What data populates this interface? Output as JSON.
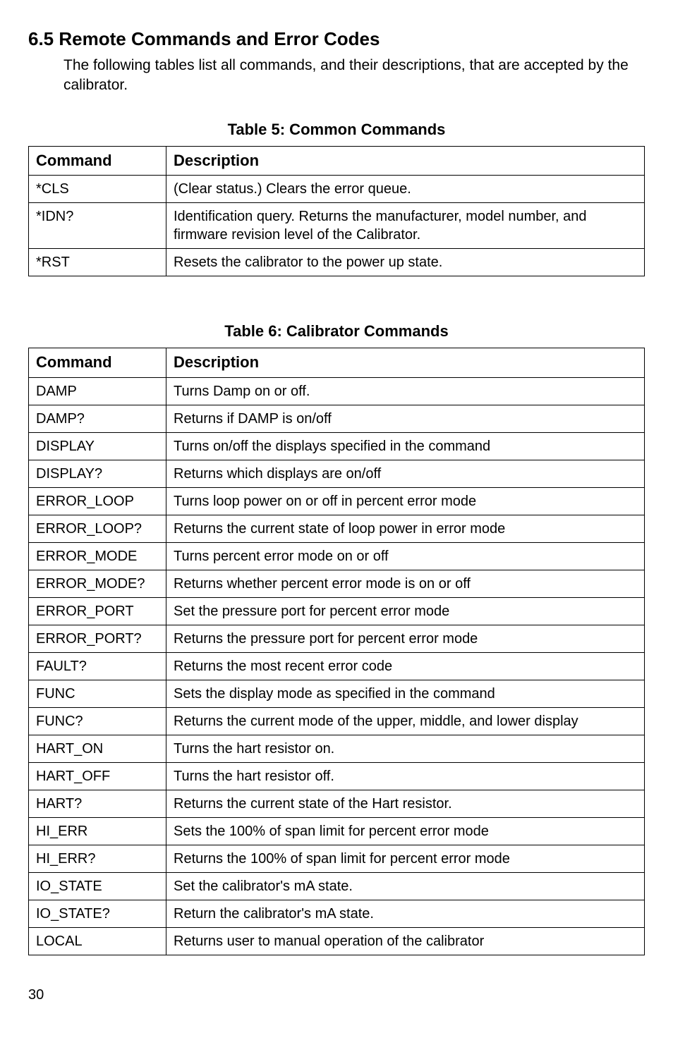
{
  "section": {
    "heading": "6.5 Remote Commands and Error Codes",
    "intro": "The following tables list all commands, and their descriptions, that are accepted by the calibrator."
  },
  "table5": {
    "title": "Table 5: Common Commands",
    "headers": {
      "command": "Command",
      "description": "Description"
    },
    "rows": [
      {
        "command": "*CLS",
        "description": "(Clear status.) Clears the error queue."
      },
      {
        "command": "*IDN?",
        "description": "Identification query. Returns the manufacturer, model number, and firmware revision level of the Calibrator."
      },
      {
        "command": "*RST",
        "description": "Resets the calibrator to the power up state."
      }
    ]
  },
  "table6": {
    "title": "Table 6: Calibrator Commands",
    "headers": {
      "command": "Command",
      "description": "Description"
    },
    "rows": [
      {
        "command": "DAMP",
        "description": "Turns Damp on or off."
      },
      {
        "command": "DAMP?",
        "description": "Returns if DAMP is on/off"
      },
      {
        "command": "DISPLAY",
        "description": "Turns on/off the displays specified in the command"
      },
      {
        "command": "DISPLAY?",
        "description": "Returns which displays are on/off"
      },
      {
        "command": "ERROR_LOOP",
        "description": "Turns loop power on or off in percent error mode"
      },
      {
        "command": "ERROR_LOOP?",
        "description": "Returns the current state of loop power in error mode"
      },
      {
        "command": "ERROR_MODE",
        "description": "Turns percent error mode on or off"
      },
      {
        "command": "ERROR_MODE?",
        "description": "Returns whether percent error mode is on or off"
      },
      {
        "command": "ERROR_PORT",
        "description": "Set the pressure port for percent error mode"
      },
      {
        "command": "ERROR_PORT?",
        "description": "Returns the pressure port for percent error mode"
      },
      {
        "command": "FAULT?",
        "description": "Returns the most recent error code"
      },
      {
        "command": "FUNC",
        "description": "Sets the display mode as specified in the command"
      },
      {
        "command": "FUNC?",
        "description": "Returns the current mode of the upper, middle, and lower display"
      },
      {
        "command": "HART_ON",
        "description": "Turns the hart resistor on."
      },
      {
        "command": "HART_OFF",
        "description": "Turns the hart resistor off."
      },
      {
        "command": "HART?",
        "description": "Returns the current state of the Hart resistor."
      },
      {
        "command": "HI_ERR",
        "description": "Sets the 100% of span limit for percent error mode"
      },
      {
        "command": "HI_ERR?",
        "description": "Returns the 100% of span limit for percent error mode"
      },
      {
        "command": "IO_STATE",
        "description": "Set the calibrator's mA state."
      },
      {
        "command": "IO_STATE?",
        "description": "Return the calibrator's mA state."
      },
      {
        "command": "LOCAL",
        "description": "Returns user to manual operation of the calibrator"
      }
    ]
  },
  "pageNumber": "30"
}
